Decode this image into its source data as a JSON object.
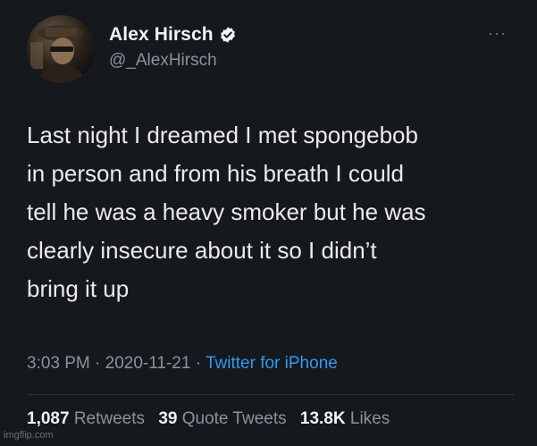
{
  "user": {
    "name": "Alex Hirsch",
    "handle": "@_AlexHirsch"
  },
  "more_label": "···",
  "tweet": {
    "text": "Last night I dreamed I met spongebob\nin person and from his breath I could\ntell he was a heavy smoker but he was\nclearly insecure about it so I didn’t\nbring it up",
    "time": "3:03 PM",
    "sep1": " · ",
    "date": "2020-11-21",
    "sep2": " · ",
    "source": "Twitter for iPhone"
  },
  "stats": {
    "retweets_count": "1,087",
    "retweets_label": "Retweets",
    "quotes_count": "39",
    "quotes_label": "Quote Tweets",
    "likes_count": "13.8K",
    "likes_label": "Likes"
  },
  "watermark": "imgflip.com",
  "colors": {
    "background": "#15181d",
    "accent": "#2f9bf0",
    "muted_text": "#8b939c"
  },
  "icons": {
    "verified": "verified-badge-icon",
    "more": "more-options-icon"
  }
}
